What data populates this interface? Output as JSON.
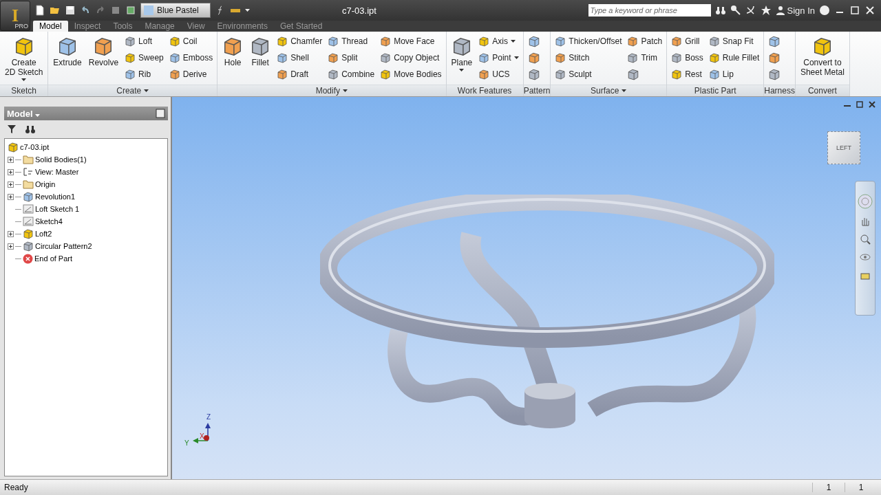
{
  "app_button": {
    "letter": "I",
    "edition": "PRO"
  },
  "appearance": {
    "value": "Blue Pastel"
  },
  "window": {
    "title": "c7-03.ipt"
  },
  "search": {
    "placeholder": "Type a keyword or phrase"
  },
  "sign_in": "Sign In",
  "tabs": [
    {
      "label": "Model",
      "selected": true
    },
    {
      "label": "Inspect",
      "selected": false
    },
    {
      "label": "Tools",
      "selected": false
    },
    {
      "label": "Manage",
      "selected": false
    },
    {
      "label": "View",
      "selected": false
    },
    {
      "label": "Environments",
      "selected": false
    },
    {
      "label": "Get Started",
      "selected": false
    }
  ],
  "panels": [
    {
      "title": "Sketch",
      "menu": false,
      "groups": [
        {
          "kind": "large",
          "label": "Create\n2D Sketch",
          "caret": true
        }
      ]
    },
    {
      "title": "Create",
      "menu": true,
      "groups": [
        {
          "kind": "large",
          "label": "Extrude",
          "caret": false
        },
        {
          "kind": "large",
          "label": "Revolve",
          "caret": false
        },
        {
          "kind": "column",
          "items": [
            {
              "label": "Loft",
              "caret": false
            },
            {
              "label": "Sweep",
              "caret": false
            },
            {
              "label": "Rib",
              "caret": false
            }
          ]
        },
        {
          "kind": "column",
          "items": [
            {
              "label": "Coil",
              "caret": false
            },
            {
              "label": "Emboss",
              "caret": false
            },
            {
              "label": "Derive",
              "caret": false
            }
          ]
        }
      ]
    },
    {
      "title": "Modify",
      "menu": true,
      "groups": [
        {
          "kind": "large",
          "label": "Hole",
          "caret": false
        },
        {
          "kind": "large",
          "label": "Fillet",
          "caret": false
        },
        {
          "kind": "column",
          "items": [
            {
              "label": "Chamfer",
              "caret": false
            },
            {
              "label": "Shell",
              "caret": false
            },
            {
              "label": "Draft",
              "caret": false
            }
          ]
        },
        {
          "kind": "column",
          "items": [
            {
              "label": "Thread",
              "caret": false
            },
            {
              "label": "Split",
              "caret": false
            },
            {
              "label": "Combine",
              "caret": false
            }
          ]
        },
        {
          "kind": "column",
          "items": [
            {
              "label": "Move Face",
              "caret": false
            },
            {
              "label": "Copy Object",
              "caret": false
            },
            {
              "label": "Move Bodies",
              "caret": false
            }
          ]
        }
      ]
    },
    {
      "title": "Work Features",
      "menu": false,
      "groups": [
        {
          "kind": "large",
          "label": "Plane",
          "caret": true
        },
        {
          "kind": "column",
          "items": [
            {
              "label": "Axis",
              "caret": true
            },
            {
              "label": "Point",
              "caret": true
            },
            {
              "label": "UCS",
              "caret": false
            }
          ]
        }
      ]
    },
    {
      "title": "Pattern",
      "menu": false,
      "groups": [
        {
          "kind": "icons",
          "items": [
            {
              "kind": "icon"
            },
            {
              "kind": "icon"
            },
            {
              "kind": "icon"
            }
          ]
        }
      ]
    },
    {
      "title": "Surface",
      "menu": true,
      "groups": [
        {
          "kind": "column",
          "items": [
            {
              "label": "Thicken/Offset",
              "caret": false
            },
            {
              "label": "Stitch",
              "caret": false
            },
            {
              "label": "Sculpt",
              "caret": false
            }
          ]
        },
        {
          "kind": "column",
          "items": [
            {
              "label": "Patch",
              "caret": false
            },
            {
              "label": "Trim",
              "caret": false
            },
            {
              "kind": "icon"
            }
          ]
        }
      ]
    },
    {
      "title": "Plastic Part",
      "menu": false,
      "groups": [
        {
          "kind": "column",
          "items": [
            {
              "label": "Grill",
              "caret": false
            },
            {
              "label": "Boss",
              "caret": false
            },
            {
              "label": "Rest",
              "caret": false
            }
          ]
        },
        {
          "kind": "column",
          "items": [
            {
              "label": "Snap Fit",
              "caret": false
            },
            {
              "label": "Rule Fillet",
              "caret": false
            },
            {
              "label": "Lip",
              "caret": false
            }
          ]
        }
      ]
    },
    {
      "title": "Harness",
      "menu": false,
      "groups": [
        {
          "kind": "icons",
          "items": [
            {
              "kind": "icon"
            },
            {
              "kind": "icon"
            },
            {
              "kind": "icon"
            }
          ]
        }
      ]
    },
    {
      "title": "Convert",
      "menu": false,
      "groups": [
        {
          "kind": "large",
          "label": "Convert to\nSheet Metal",
          "caret": false
        }
      ]
    }
  ],
  "browser": {
    "title": "Model",
    "tree": {
      "label": "c7-03.ipt",
      "children": [
        {
          "label": "Solid Bodies(1)",
          "kind": "folder",
          "expandable": true
        },
        {
          "label": "View: Master",
          "kind": "view",
          "expandable": true
        },
        {
          "label": "Origin",
          "kind": "folder",
          "expandable": true
        },
        {
          "label": "Revolution1",
          "kind": "revolve",
          "expandable": true
        },
        {
          "label": "Loft Sketch 1",
          "kind": "sketch",
          "expandable": false
        },
        {
          "label": "Sketch4",
          "kind": "sketch",
          "expandable": false
        },
        {
          "label": "Loft2",
          "kind": "loft",
          "expandable": true
        },
        {
          "label": "Circular Pattern2",
          "kind": "pattern",
          "expandable": true
        },
        {
          "label": "End of Part",
          "kind": "end",
          "expandable": false
        }
      ]
    }
  },
  "view_cube": {
    "face": "LEFT"
  },
  "triad": {
    "z": "Z",
    "x": "X",
    "y": "Y"
  },
  "status_bar": {
    "message": "Ready",
    "field_1": "1",
    "field_2": "1"
  }
}
